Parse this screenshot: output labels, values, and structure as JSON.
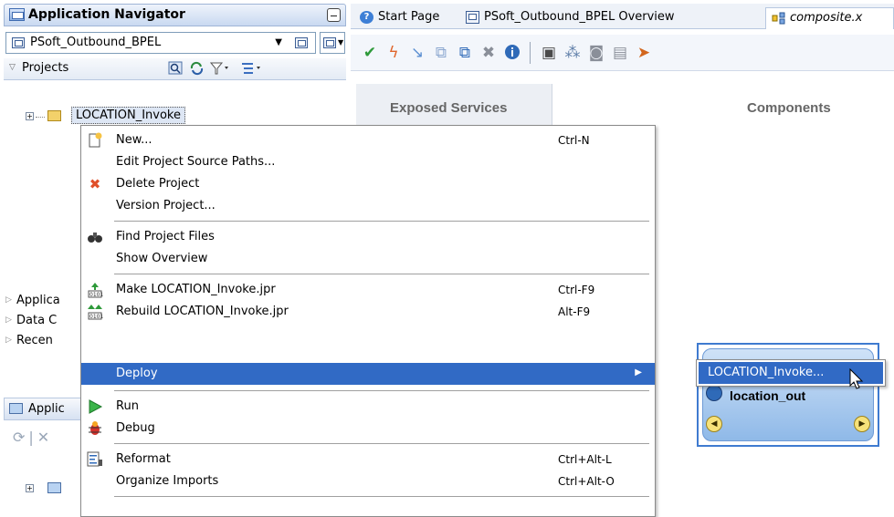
{
  "navigator": {
    "title": "Application Navigator",
    "application_selector": "PSoft_Outbound_BPEL",
    "projects_label": "Projects",
    "tree": {
      "project": "LOCATION_Invoke"
    },
    "accordions": [
      "Applica",
      "Data C",
      "Recen"
    ],
    "lower_panel_label": "Applic"
  },
  "editor": {
    "tabs": [
      {
        "label": "Start Page",
        "icon": "help-icon"
      },
      {
        "label": "PSoft_Outbound_BPEL Overview",
        "icon": "overview-icon"
      },
      {
        "label": "composite.x",
        "icon": "composite-icon"
      }
    ],
    "columns": {
      "exposed": "Exposed Services",
      "components": "Components"
    },
    "component": {
      "name": "location_out"
    }
  },
  "context_menu": {
    "items": [
      {
        "label": "New...",
        "accel": "Ctrl-N",
        "icon": "new-icon"
      },
      {
        "label": "Edit Project Source Paths...",
        "accel": ""
      },
      {
        "label": "Delete Project",
        "accel": "",
        "icon": "delete-icon"
      },
      {
        "label": "Version Project...",
        "accel": ""
      },
      {
        "label": "Find Project Files",
        "accel": "",
        "icon": "binoculars-icon"
      },
      {
        "label": "Show Overview",
        "accel": ""
      },
      {
        "label": "Make LOCATION_Invoke.jpr",
        "accel": "Ctrl-F9",
        "icon": "make-icon"
      },
      {
        "label": "Rebuild LOCATION_Invoke.jpr",
        "accel": "Alt-F9",
        "icon": "rebuild-icon"
      },
      {
        "label": "Deploy",
        "accel": "",
        "has_submenu": true
      },
      {
        "label": "Run",
        "accel": "",
        "icon": "run-icon"
      },
      {
        "label": "Debug",
        "accel": "",
        "icon": "debug-icon"
      },
      {
        "label": "Reformat",
        "accel": "Ctrl+Alt-L",
        "icon": "reformat-icon"
      },
      {
        "label": "Organize Imports",
        "accel": "Ctrl+Alt-O"
      }
    ],
    "deploy_submenu": [
      "LOCATION_Invoke..."
    ]
  },
  "colors": {
    "menu_highlight": "#316ac5",
    "header_gradient_top": "#eef3fb",
    "header_gradient_bottom": "#c9d9f1"
  }
}
